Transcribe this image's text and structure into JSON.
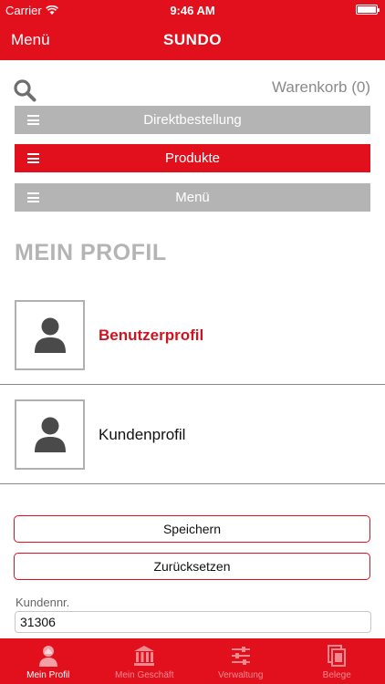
{
  "status_bar": {
    "carrier": "Carrier",
    "time": "9:46 AM"
  },
  "nav": {
    "menu_label": "Menü",
    "title": "SUNDO"
  },
  "cart_label": "Warenkorb (0)",
  "menu_bars": [
    {
      "label": "Direktbestellung",
      "color": "#b4b4b4"
    },
    {
      "label": "Produkte",
      "color": "#e2101d"
    },
    {
      "label": "Menü",
      "color": "#b4b4b4"
    }
  ],
  "section_title": "MEIN PROFIL",
  "profiles": [
    {
      "label": "Benutzerprofil",
      "selected": true
    },
    {
      "label": "Kundenprofil",
      "selected": false
    }
  ],
  "buttons": {
    "save": "Speichern",
    "reset": "Zurücksetzen"
  },
  "customer_field": {
    "label": "Kundennr.",
    "value": "31306"
  },
  "tabs": [
    {
      "label": "Mein Profil",
      "icon": "person-icon",
      "active": true
    },
    {
      "label": "Mein Geschäft",
      "icon": "bank-icon",
      "active": false
    },
    {
      "label": "Verwaltung",
      "icon": "sliders-icon",
      "active": false
    },
    {
      "label": "Belege",
      "icon": "documents-icon",
      "active": false
    }
  ],
  "colors": {
    "accent": "#e2101d",
    "bar_gray": "#b4b4b4",
    "heading_gray": "#b4b4b4"
  }
}
